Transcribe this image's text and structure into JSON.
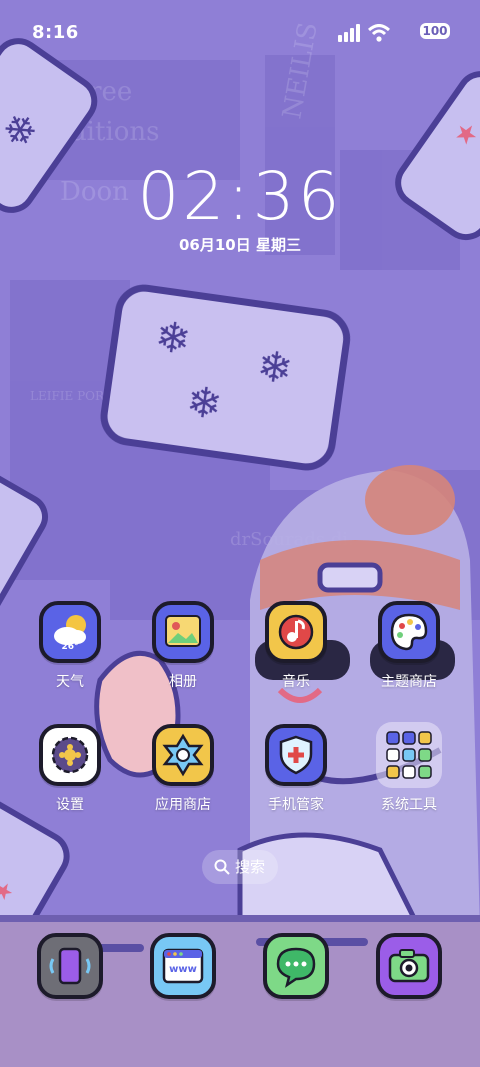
{
  "status_bar": {
    "time": "8:16",
    "battery": "100",
    "icons": [
      "signal-icon",
      "wifi-icon",
      "battery-icon"
    ]
  },
  "lock_clock": {
    "time": "02:36",
    "date": "06月10日 星期三"
  },
  "apps": [
    {
      "label": "天气",
      "icon": "weather-icon",
      "badge": "26°"
    },
    {
      "label": "相册",
      "icon": "gallery-icon"
    },
    {
      "label": "音乐",
      "icon": "music-icon"
    },
    {
      "label": "主题商店",
      "icon": "theme-store-icon"
    },
    {
      "label": "设置",
      "icon": "settings-icon"
    },
    {
      "label": "应用商店",
      "icon": "app-store-icon"
    },
    {
      "label": "手机管家",
      "icon": "security-icon"
    },
    {
      "label": "系统工具",
      "icon": "folder-icon"
    }
  ],
  "search": {
    "label": "搜索",
    "icon": "search-icon"
  },
  "dock": [
    {
      "icon": "phone-icon"
    },
    {
      "icon": "browser-icon",
      "text": "www"
    },
    {
      "icon": "messages-icon"
    },
    {
      "icon": "camera-icon"
    }
  ],
  "colors": {
    "wallpaper": "#8f7fd6",
    "dock": "#a890c6",
    "outline": "#1d1b2b",
    "tile_blue": "#5a63e6",
    "tile_yellow": "#f2c64a",
    "tile_white": "#ffffff",
    "tile_green": "#7ed987",
    "tile_purple": "#9b5de8",
    "tile_gray": "#6e6e76",
    "tile_lightblue": "#78c8f5"
  }
}
